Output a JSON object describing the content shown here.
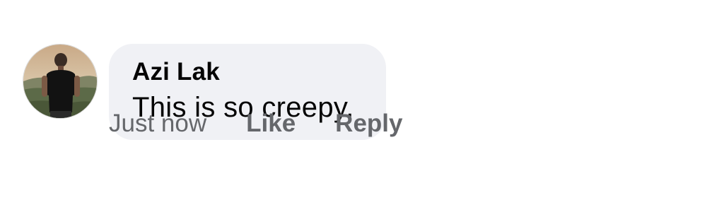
{
  "comment": {
    "author": "Azi Lak",
    "text": "This is so creepy.",
    "avatar": "user-profile-photo-icon",
    "actions": {
      "timestamp": "Just now",
      "like_label": "Like",
      "reply_label": "Reply"
    }
  },
  "colors": {
    "bubble": "#f0f1f5",
    "text": "#050505",
    "muted": "#65676b"
  }
}
